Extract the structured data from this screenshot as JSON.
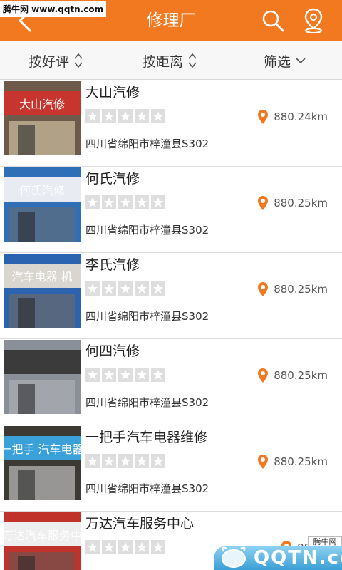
{
  "header": {
    "title": "修理厂",
    "color": "#f37920",
    "back_icon": "chevron-left-icon",
    "search_icon": "search-icon",
    "location_icon": "location-pin-icon"
  },
  "watermark_top": "腾牛网 www.qqtn.com",
  "watermark_bottom": {
    "badge": "腾牛网",
    "logo": "QQTN.com"
  },
  "sortbar": {
    "items": [
      {
        "label": "按好评",
        "icon": "sort-arrows-icon"
      },
      {
        "label": "按距离",
        "icon": "sort-arrows-icon"
      },
      {
        "label": "筛选",
        "icon": "chevron-down-icon"
      }
    ]
  },
  "shops": [
    {
      "name": "大山汽修",
      "distance": "880.24km",
      "address": "四川省绵阳市梓潼县S302",
      "rating": 0,
      "sign_text": "大山汽修"
    },
    {
      "name": "何氏汽修",
      "distance": "880.25km",
      "address": "四川省绵阳市梓潼县S302",
      "rating": 0,
      "sign_text": "何氏汽修"
    },
    {
      "name": "李氏汽修",
      "distance": "880.25km",
      "address": "四川省绵阳市梓潼县S302",
      "rating": 0,
      "sign_text": "汽车电器 机"
    },
    {
      "name": "何四汽修",
      "distance": "880.25km",
      "address": "四川省绵阳市梓潼县S302",
      "rating": 0,
      "sign_text": ""
    },
    {
      "name": "一把手汽车电器维修",
      "distance": "880.25km",
      "address": "四川省绵阳市梓潼县S302",
      "rating": 0,
      "sign_text": "一把手 汽车电器"
    },
    {
      "name": "万达汽车服务中心",
      "distance": "880.2",
      "address": "",
      "rating": 0,
      "sign_text": "万达汽车服务中"
    }
  ]
}
